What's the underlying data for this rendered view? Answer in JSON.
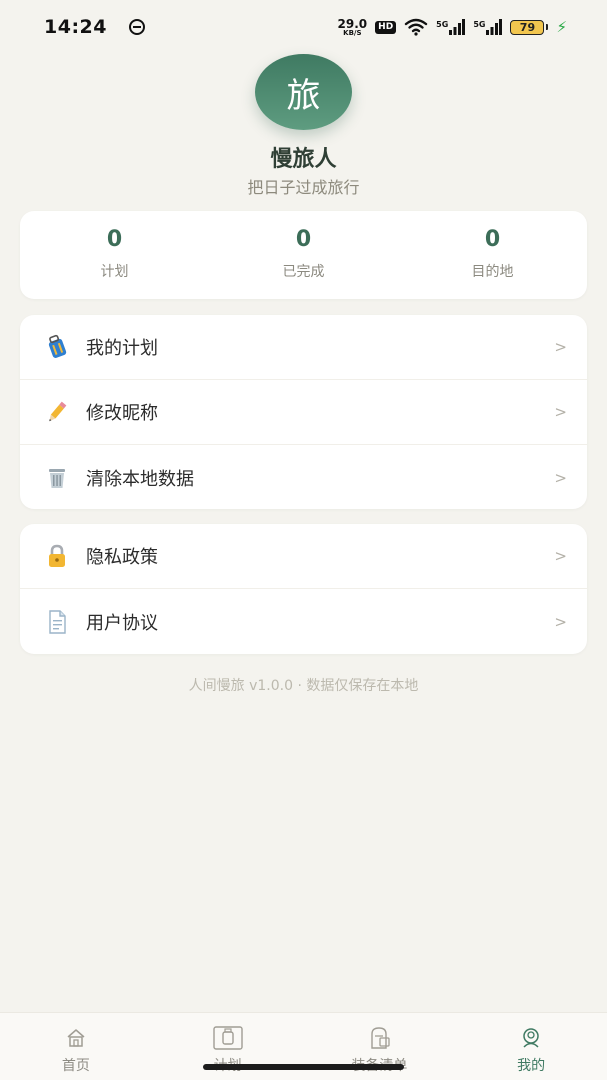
{
  "status_bar": {
    "time": "14:24",
    "speed_value": "29.0",
    "speed_unit": "KB/S",
    "hd": "HD",
    "signal_1": "5G",
    "signal_2": "5G",
    "battery": "79",
    "charging_glyph": "⚡"
  },
  "profile": {
    "avatar_char": "旅",
    "nickname": "慢旅人",
    "motto": "把日子过成旅行"
  },
  "stats": [
    {
      "value": "0",
      "label": "计划"
    },
    {
      "value": "0",
      "label": "已完成"
    },
    {
      "value": "0",
      "label": "目的地"
    }
  ],
  "menu_group_1": [
    {
      "label": "我的计划",
      "icon": "luggage-icon"
    },
    {
      "label": "修改昵称",
      "icon": "pencil-icon"
    },
    {
      "label": "清除本地数据",
      "icon": "trash-icon"
    }
  ],
  "menu_group_2": [
    {
      "label": "隐私政策",
      "icon": "lock-icon"
    },
    {
      "label": "用户协议",
      "icon": "document-icon"
    }
  ],
  "arrow": ">",
  "footer": "人间慢旅 v1.0.0 · 数据仅保存在本地",
  "tabs": [
    {
      "label": "首页",
      "icon": "home-icon"
    },
    {
      "label": "计划",
      "icon": "plan-icon"
    },
    {
      "label": "装备清单",
      "icon": "backpack-icon"
    },
    {
      "label": "我的",
      "icon": "profile-icon",
      "active": true
    }
  ],
  "colors": {
    "accent": "#3f7a62",
    "background": "#f4f3ee",
    "card": "#ffffff"
  }
}
